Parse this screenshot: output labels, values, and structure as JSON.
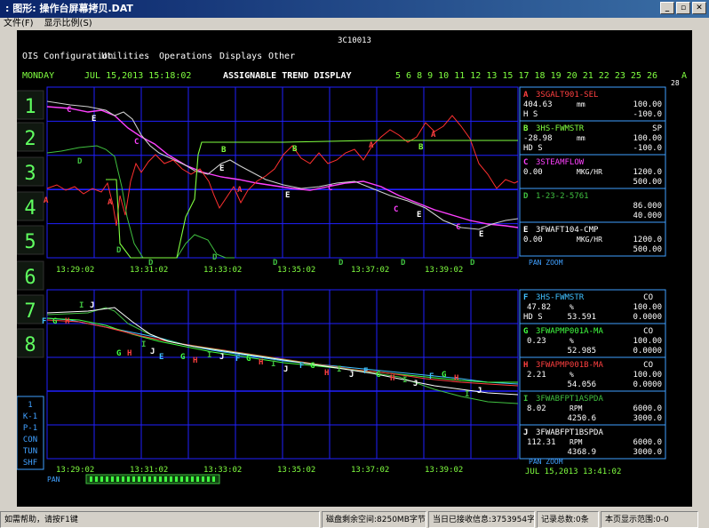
{
  "window": {
    "title": ": 图形: 操作台屏幕拷贝.DAT"
  },
  "menu": [
    "文件(F)",
    "显示比例(S)"
  ],
  "screen": {
    "node": "3C10013",
    "ois_menu": [
      "OIS Configuration",
      "Utilities",
      "Operations",
      "Displays",
      "Other"
    ],
    "header": {
      "day": "MONDAY",
      "datetime": "JUL 15,2013  15:18:02",
      "title": "ASSIGNABLE TREND DISPLAY",
      "page_numbers": "5 6 8 9 10 11 12 13 15 17 18 19 20 21 22 23 25 26",
      "page_letter": "A",
      "page_sub": "28"
    },
    "side_numbers": [
      "1",
      "2",
      "3",
      "4",
      "5",
      "6",
      "7",
      "8"
    ],
    "top_time_labels": [
      "13:29:02",
      "13:31:02",
      "13:33:02",
      "13:35:02",
      "13:37:02",
      "13:39:02"
    ],
    "bottom_time_labels": [
      "13:29:02",
      "13:31:02",
      "13:33:02",
      "13:35:02",
      "13:37:02",
      "13:39:02"
    ],
    "top_pan_zoom": "PAN      ZOOM",
    "bottom_pan_zoom": "PAN      ZOOM",
    "bottom_right_datetime": "JUL 15,2013 13:41:02",
    "left_status": [
      "1",
      "K-1",
      "P-1",
      "CON",
      "TUN",
      "SHF"
    ],
    "pan_label": "PAN",
    "top_panel": [
      {
        "letter": "A",
        "tag": "3SGALT901-SEL",
        "value": "404.63",
        "unit": "mm",
        "mode": "H S",
        "hi": "100.00",
        "lo": "-100.0",
        "color": "#ff4040",
        "tag_color": "#ff4040"
      },
      {
        "letter": "B",
        "tag": "3HS-FWMSTR",
        "value": "-28.98",
        "unit": "mm",
        "mode": "HD S",
        "hi": "SP",
        "hi2": "100.00",
        "lo": "-100.0",
        "color": "#80ff40",
        "tag_color": "#80ff40"
      },
      {
        "letter": "C",
        "tag": "3STEAMFLOW",
        "value": "0.00",
        "unit": "MKG/HR",
        "hi": "1200.0",
        "lo": "500.00",
        "color": "#ff40ff",
        "tag_color": "#ff40ff"
      },
      {
        "letter": "D",
        "tag": "1-23-2-5761",
        "value": "",
        "unit": "",
        "hi": "86.000",
        "lo": "40.000",
        "color": "#40c040",
        "tag_color": "#40c040"
      },
      {
        "letter": "E",
        "tag": "3FWAFT104-CMP",
        "value": "0.00",
        "unit": "MKG/HR",
        "hi": "1200.0",
        "lo": "500.00",
        "color": "#ffffff",
        "tag_color": "#ffffff"
      }
    ],
    "bottom_panel": [
      {
        "letter": "F",
        "tag": "3HS-FWMSTR",
        "mode_top": "CO",
        "value": "47.82",
        "unit": "%",
        "mode": "HD S",
        "extra": "53.591",
        "hi": "100.00",
        "lo": "0.0000",
        "color": "#40c0ff"
      },
      {
        "letter": "G",
        "tag": "3FWAPMP001A-MA",
        "mode_top": "CO",
        "value": "0.23",
        "unit": "%",
        "mode": "",
        "extra": "52.985",
        "hi": "100.00",
        "lo": "0.0000",
        "color": "#40ff40"
      },
      {
        "letter": "H",
        "tag": "3FWAPMP001B-MA",
        "mode_top": "CO",
        "value": "2.21",
        "unit": "%",
        "mode": "",
        "extra": "54.056",
        "hi": "100.00",
        "lo": "0.0000",
        "color": "#ff4040"
      },
      {
        "letter": "I",
        "tag": "3FWABFPT1ASPDA",
        "mode_top": "",
        "value": "8.02",
        "unit": "RPM",
        "mode": "",
        "extra": "4250.6",
        "hi": "6000.0",
        "lo": "3000.0",
        "color": "#40c040"
      },
      {
        "letter": "J",
        "tag": "3FWABFPT1BSPDA",
        "mode_top": "",
        "value": "112.31",
        "unit": "RPM",
        "mode": "",
        "extra": "4368.9",
        "hi": "6000.0",
        "lo": "3000.0",
        "color": "#ffffff"
      }
    ],
    "colors": {
      "grid": "#2020ff",
      "text_green": "#80ff40",
      "panel_border": "#40a0ff"
    }
  },
  "status": [
    "如需帮助，请按F1键",
    "磁盘剩余空间:8250MB字节",
    "当日已接收信息:3753954字节",
    "记录总数:0条",
    "本页显示范围:0-0"
  ]
}
